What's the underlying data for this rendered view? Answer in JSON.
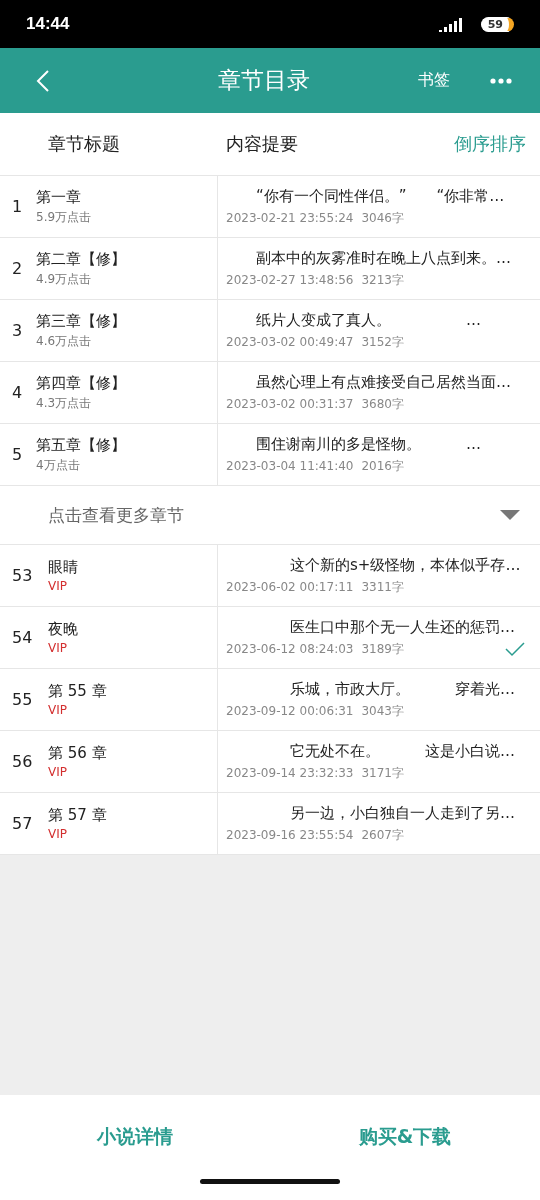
{
  "status_bar": {
    "time": "14:44",
    "battery": "59"
  },
  "app_bar": {
    "title": "章节目录",
    "bookmark": "书签"
  },
  "columns": {
    "title": "章节标题",
    "summary": "内容提要",
    "sort": "倒序排序"
  },
  "chapters": [
    {
      "number": "1",
      "title": "第一章",
      "kind": "clicks",
      "sub": "5.9万点击",
      "summary": "“你有一个同性伴侣。”　　“你非常…",
      "date": "2023-02-21 23:55:24",
      "words": "3046字",
      "checked": false
    },
    {
      "number": "2",
      "title": "第二章【修】",
      "kind": "clicks",
      "sub": "4.9万点击",
      "summary": "副本中的灰雾准时在晚上八点到来。…",
      "date": "2023-02-27 13:48:56",
      "words": "3213字",
      "checked": false
    },
    {
      "number": "3",
      "title": "第三章【修】",
      "kind": "clicks",
      "sub": "4.6万点击",
      "summary": "纸片人变成了真人。　　　　　…",
      "date": "2023-03-02 00:49:47",
      "words": "3152字",
      "checked": false
    },
    {
      "number": "4",
      "title": "第四章【修】",
      "kind": "clicks",
      "sub": "4.3万点击",
      "summary": "虽然心理上有点难接受自己居然当面…",
      "date": "2023-03-02 00:31:37",
      "words": "3680字",
      "checked": false
    },
    {
      "number": "5",
      "title": "第五章【修】",
      "kind": "clicks",
      "sub": "4万点击",
      "summary": "围住谢南川的多是怪物。　　　…",
      "date": "2023-03-04 11:41:40",
      "words": "2016字",
      "checked": false
    }
  ],
  "more": {
    "label": "点击查看更多章节"
  },
  "latest_chapters": [
    {
      "number": "53",
      "title": "眼睛",
      "kind": "vip",
      "sub": "VIP",
      "summary": "这个新的s+级怪物，本体似乎存…",
      "date": "2023-06-02 00:17:11",
      "words": "3311字",
      "checked": false
    },
    {
      "number": "54",
      "title": "夜晚",
      "kind": "vip",
      "sub": "VIP",
      "summary": "医生口中那个无一人生还的惩罚…",
      "date": "2023-06-12 08:24:03",
      "words": "3189字",
      "checked": true
    },
    {
      "number": "55",
      "title": "第 55 章",
      "kind": "vip",
      "sub": "VIP",
      "summary": "乐城，市政大厅。　　　穿着光…",
      "date": "2023-09-12 00:06:31",
      "words": "3043字",
      "checked": false
    },
    {
      "number": "56",
      "title": "第 56 章",
      "kind": "vip",
      "sub": "VIP",
      "summary": "它无处不在。　　　这是小白说…",
      "date": "2023-09-14 23:32:33",
      "words": "3171字",
      "checked": false
    },
    {
      "number": "57",
      "title": "第 57 章",
      "kind": "vip",
      "sub": "VIP",
      "summary": "另一边，小白独自一人走到了另…",
      "date": "2023-09-16 23:55:54",
      "words": "2607字",
      "checked": false
    }
  ],
  "bottom_bar": {
    "details": "小说详情",
    "buy": "购买&下载"
  }
}
